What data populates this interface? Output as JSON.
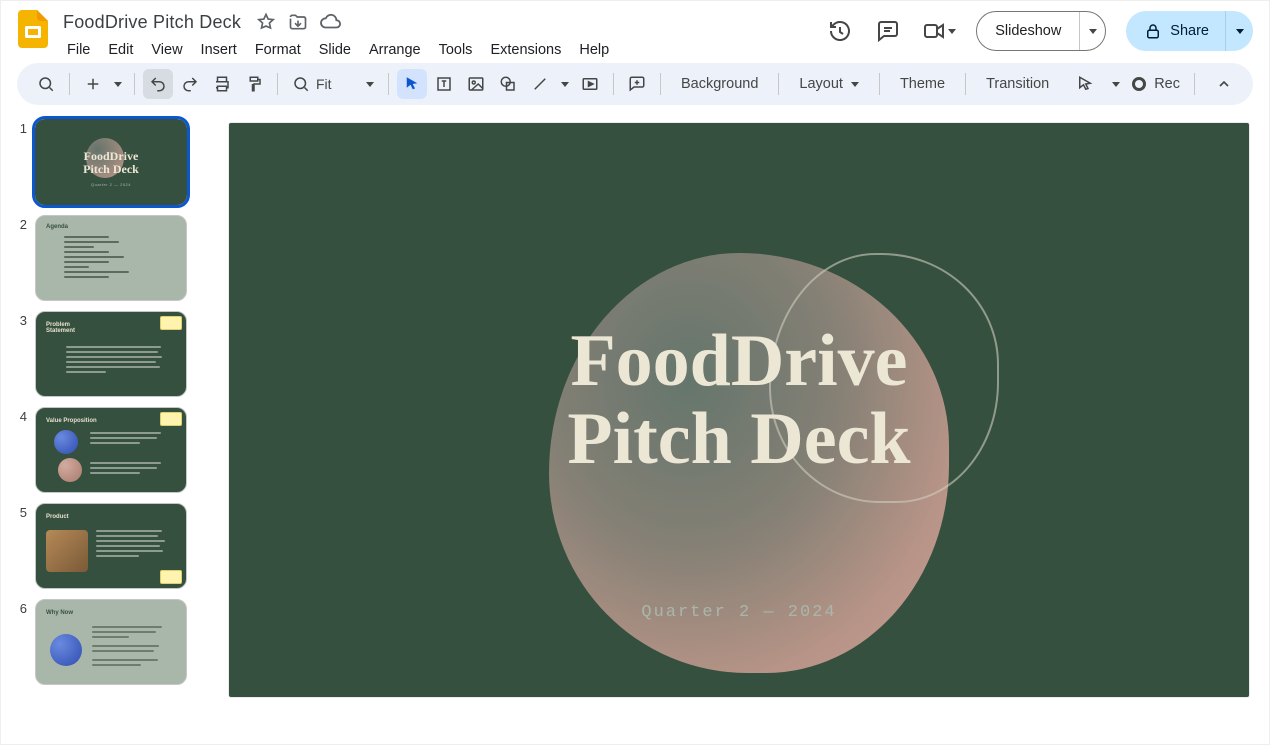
{
  "doc": {
    "title": "FoodDrive Pitch Deck"
  },
  "menus": [
    "File",
    "Edit",
    "View",
    "Insert",
    "Format",
    "Slide",
    "Arrange",
    "Tools",
    "Extensions",
    "Help"
  ],
  "header": {
    "slideshow_label": "Slideshow",
    "share_label": "Share"
  },
  "toolbar": {
    "zoom_label": "Fit",
    "background": "Background",
    "layout": "Layout",
    "theme": "Theme",
    "transition": "Transition",
    "rec": "Rec"
  },
  "thumbnails": [
    {
      "num": "1",
      "variant": "dark",
      "selected": true,
      "title_line1": "FoodDrive",
      "title_line2": "Pitch Deck",
      "subtitle": "Quarter 2 — 2024"
    },
    {
      "num": "2",
      "variant": "light",
      "heading": "Agenda"
    },
    {
      "num": "3",
      "variant": "dark",
      "heading": "Problem\nStatement",
      "sticky": "tr"
    },
    {
      "num": "4",
      "variant": "dark",
      "heading": "Value Proposition",
      "sticky": "tr"
    },
    {
      "num": "5",
      "variant": "dark",
      "heading": "Product",
      "sticky": "br"
    },
    {
      "num": "6",
      "variant": "light",
      "heading": "Why Now"
    }
  ],
  "slide": {
    "title_line1": "FoodDrive",
    "title_line2": "Pitch Deck",
    "subtitle": "Quarter 2 — 2024"
  }
}
